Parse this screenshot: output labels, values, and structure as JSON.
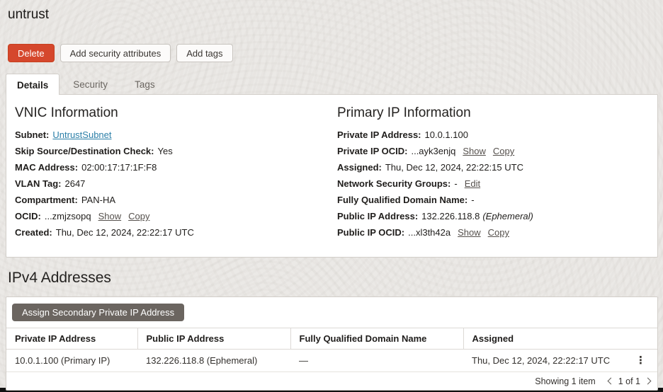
{
  "page": {
    "title": "untrust"
  },
  "actions": {
    "delete": "Delete",
    "add_security_attributes": "Add security attributes",
    "add_tags": "Add tags"
  },
  "tabs": [
    {
      "label": "Details",
      "active": true
    },
    {
      "label": "Security",
      "active": false
    },
    {
      "label": "Tags",
      "active": false
    }
  ],
  "vnic_info": {
    "heading": "VNIC Information",
    "fields": [
      {
        "label": "Subnet:",
        "link": "UntrustSubnet"
      },
      {
        "label": "Skip Source/Destination Check:",
        "value": "Yes"
      },
      {
        "label": "MAC Address:",
        "value": "02:00:17:17:1F:F8"
      },
      {
        "label": "VLAN Tag:",
        "value": "2647"
      },
      {
        "label": "Compartment:",
        "value": "PAN-HA"
      },
      {
        "label": "OCID:",
        "value": "...zmjzsopq",
        "actions": [
          "Show",
          "Copy"
        ]
      },
      {
        "label": "Created:",
        "value": "Thu, Dec 12, 2024, 22:22:17 UTC"
      }
    ]
  },
  "primary_ip_info": {
    "heading": "Primary IP Information",
    "fields": [
      {
        "label": "Private IP Address:",
        "value": "10.0.1.100"
      },
      {
        "label": "Private IP OCID:",
        "value": "...ayk3enjq",
        "actions": [
          "Show",
          "Copy"
        ]
      },
      {
        "label": "Assigned:",
        "value": "Thu, Dec 12, 2024, 22:22:15 UTC"
      },
      {
        "label": "Network Security Groups:",
        "value": "-",
        "actions": [
          "Edit"
        ]
      },
      {
        "label": "Fully Qualified Domain Name:",
        "value": "-"
      },
      {
        "label": "Public IP Address:",
        "value": "132.226.118.8",
        "italic": "(Ephemeral)"
      },
      {
        "label": "Public IP OCID:",
        "value": "...xl3th42a",
        "actions": [
          "Show",
          "Copy"
        ]
      }
    ]
  },
  "ipv4": {
    "heading": "IPv4 Addresses",
    "assign_button": "Assign Secondary Private IP Address",
    "table": {
      "columns": [
        "Private IP Address",
        "Public IP Address",
        "Fully Qualified Domain Name",
        "Assigned"
      ],
      "row": {
        "private_ip": "10.0.1.100 (Primary IP)",
        "public_ip": "132.226.118.8 (Ephemeral)",
        "fqdn": "—",
        "assigned": "Thu, Dec 12, 2024, 22:22:17 UTC"
      },
      "kebab_icon": "⋮"
    },
    "pagination": {
      "summary": "Showing 1 item",
      "page_label": "1 of 1"
    }
  },
  "colors": {
    "danger_red": "#d5472c",
    "link_blue": "#2b7fa8",
    "assign_button_grey": "#6b6560",
    "page_background": "#ebe9e6"
  }
}
